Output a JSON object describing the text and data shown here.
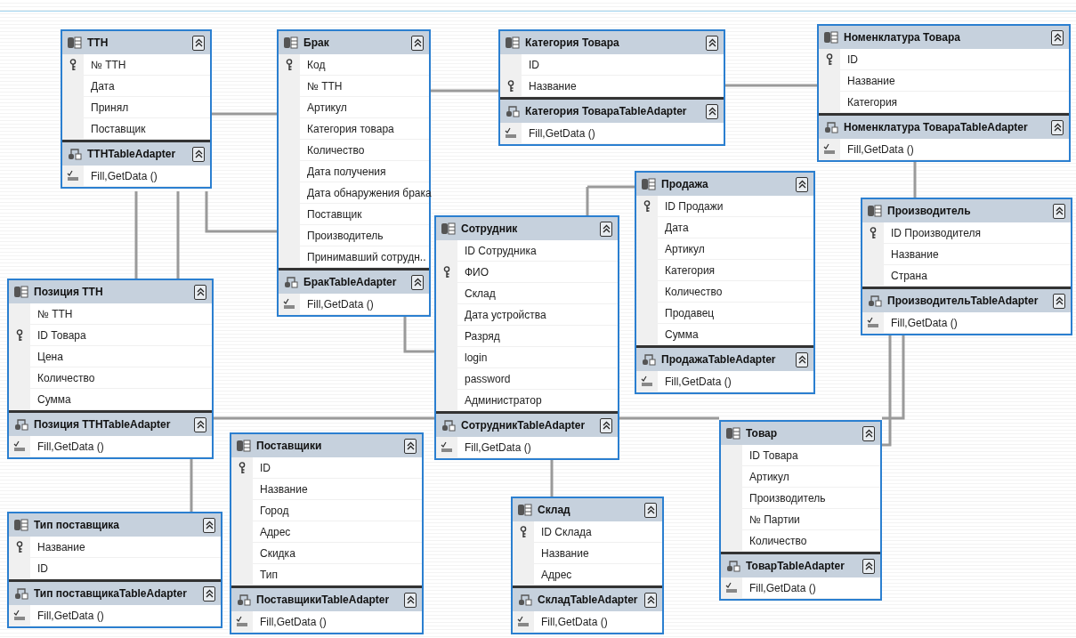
{
  "tables": [
    {
      "name": "ТТН",
      "fields": [
        {
          "name": "№ ТТН",
          "key": true
        },
        {
          "name": "Дата",
          "key": false
        },
        {
          "name": "Принял",
          "key": false
        },
        {
          "name": "Поставщик",
          "key": false
        }
      ],
      "adapter": "ТТНTableAdapter",
      "methods": [
        "Fill,GetData ()"
      ]
    },
    {
      "name": "Брак",
      "fields": [
        {
          "name": "Код",
          "key": true
        },
        {
          "name": "№ ТТН",
          "key": false
        },
        {
          "name": "Артикул",
          "key": false
        },
        {
          "name": "Категория товара",
          "key": false
        },
        {
          "name": "Количество",
          "key": false
        },
        {
          "name": "Дата получения",
          "key": false
        },
        {
          "name": "Дата обнаружения брака",
          "key": false
        },
        {
          "name": "Поставщик",
          "key": false
        },
        {
          "name": "Производитель",
          "key": false
        },
        {
          "name": "Принимавший сотрудн..",
          "key": false
        }
      ],
      "adapter": "БракTableAdapter",
      "methods": [
        "Fill,GetData ()"
      ]
    },
    {
      "name": "Категория Товара",
      "fields": [
        {
          "name": "ID",
          "key": false
        },
        {
          "name": "Название",
          "key": true
        }
      ],
      "adapter": "Категория ТовараTableAdapter",
      "methods": [
        "Fill,GetData ()"
      ]
    },
    {
      "name": "Номенклатура Товара",
      "fields": [
        {
          "name": "ID",
          "key": true
        },
        {
          "name": "Название",
          "key": false
        },
        {
          "name": "Категория",
          "key": false
        }
      ],
      "adapter": "Номенклатура ТовараTableAdapter",
      "methods": [
        "Fill,GetData ()"
      ]
    },
    {
      "name": "Позиция ТТН",
      "fields": [
        {
          "name": "№ ТТН",
          "key": false
        },
        {
          "name": "ID Товара",
          "key": true
        },
        {
          "name": "Цена",
          "key": false
        },
        {
          "name": "Количество",
          "key": false
        },
        {
          "name": "Сумма",
          "key": false
        }
      ],
      "adapter": "Позиция ТТНTableAdapter",
      "methods": [
        "Fill,GetData ()"
      ]
    },
    {
      "name": "Тип поставщика",
      "fields": [
        {
          "name": "Название",
          "key": true
        },
        {
          "name": "ID",
          "key": false
        }
      ],
      "adapter": "Тип поставщикаTableAdapter",
      "methods": [
        "Fill,GetData ()"
      ]
    },
    {
      "name": "Поставщики",
      "fields": [
        {
          "name": "ID",
          "key": true
        },
        {
          "name": "Название",
          "key": false
        },
        {
          "name": "Город",
          "key": false
        },
        {
          "name": "Адрес",
          "key": false
        },
        {
          "name": "Скидка",
          "key": false
        },
        {
          "name": "Тип",
          "key": false
        }
      ],
      "adapter": "ПоставщикиTableAdapter",
      "methods": [
        "Fill,GetData ()"
      ]
    },
    {
      "name": "Сотрудник",
      "fields": [
        {
          "name": "ID Сотрудника",
          "key": false
        },
        {
          "name": "ФИО",
          "key": true
        },
        {
          "name": "Склад",
          "key": false
        },
        {
          "name": "Дата устройства",
          "key": false
        },
        {
          "name": "Разряд",
          "key": false
        },
        {
          "name": "login",
          "key": false
        },
        {
          "name": "password",
          "key": false
        },
        {
          "name": "Администратор",
          "key": false
        }
      ],
      "adapter": "СотрудникTableAdapter",
      "methods": [
        "Fill,GetData ()"
      ]
    },
    {
      "name": "Продажа",
      "fields": [
        {
          "name": "ID Продажи",
          "key": true
        },
        {
          "name": "Дата",
          "key": false
        },
        {
          "name": "Артикул",
          "key": false
        },
        {
          "name": "Категория",
          "key": false
        },
        {
          "name": "Количество",
          "key": false
        },
        {
          "name": "Продавец",
          "key": false
        },
        {
          "name": "Сумма",
          "key": false
        }
      ],
      "adapter": "ПродажаTableAdapter",
      "methods": [
        "Fill,GetData ()"
      ]
    },
    {
      "name": "Производитель",
      "fields": [
        {
          "name": "ID Производителя",
          "key": true
        },
        {
          "name": "Название",
          "key": false
        },
        {
          "name": "Страна",
          "key": false
        }
      ],
      "adapter": "ПроизводительTableAdapter",
      "methods": [
        "Fill,GetData ()"
      ]
    },
    {
      "name": "Склад",
      "fields": [
        {
          "name": "ID Склада",
          "key": true
        },
        {
          "name": "Название",
          "key": false
        },
        {
          "name": "Адрес",
          "key": false
        }
      ],
      "adapter": "СкладTableAdapter",
      "methods": [
        "Fill,GetData ()"
      ]
    },
    {
      "name": "Товар",
      "fields": [
        {
          "name": "ID Товара",
          "key": false
        },
        {
          "name": "Артикул",
          "key": false
        },
        {
          "name": "Производитель",
          "key": false
        },
        {
          "name": "№ Партии",
          "key": false
        },
        {
          "name": "Количество",
          "key": false
        }
      ],
      "adapter": "ТоварTableAdapter",
      "methods": [
        "Fill,GetData ()"
      ]
    }
  ]
}
